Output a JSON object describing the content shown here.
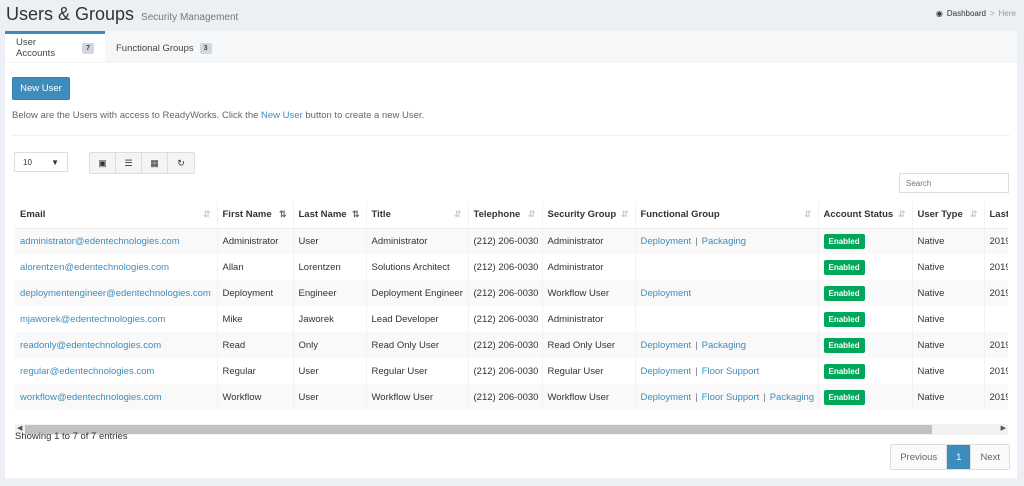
{
  "header": {
    "title": "Users & Groups",
    "subtitle": "Security Management"
  },
  "breadcrumb": {
    "home": "Dashboard",
    "sep": ">",
    "current": "Here"
  },
  "tabs": [
    {
      "label": "User Accounts",
      "count": "7"
    },
    {
      "label": "Functional Groups",
      "count": "3"
    }
  ],
  "new_user_label": "New User",
  "description": {
    "before": "Below are the Users with access to ReadyWorks. Click the ",
    "link": "New User",
    "after": " button to create a new User."
  },
  "page_length": "10",
  "search_placeholder": "Search",
  "columns": [
    "Email",
    "First Name",
    "Last Name",
    "Title",
    "Telephone",
    "Security Group",
    "Functional Group",
    "Account Status",
    "User Type",
    "Last"
  ],
  "rows": [
    {
      "email": "administrator@edentechnologies.com",
      "first": "Administrator",
      "last": "User",
      "title": "Administrator",
      "phone": "(212) 206-0030",
      "sec": "Administrator",
      "groups": [
        "Deployment",
        "Packaging"
      ],
      "status": "Enabled",
      "type": "Native",
      "lastcol": "2019"
    },
    {
      "email": "alorentzen@edentechnologies.com",
      "first": "Allan",
      "last": "Lorentzen",
      "title": "Solutions Architect",
      "phone": "(212) 206-0030",
      "sec": "Administrator",
      "groups": [],
      "status": "Enabled",
      "type": "Native",
      "lastcol": "2019"
    },
    {
      "email": "deploymentengineer@edentechnologies.com",
      "first": "Deployment",
      "last": "Engineer",
      "title": "Deployment Engineer",
      "phone": "(212) 206-0030",
      "sec": "Workflow User",
      "groups": [
        "Deployment"
      ],
      "status": "Enabled",
      "type": "Native",
      "lastcol": "2019"
    },
    {
      "email": "mjaworek@edentechnologies.com",
      "first": "Mike",
      "last": "Jaworek",
      "title": "Lead Developer",
      "phone": "(212) 206-0030",
      "sec": "Administrator",
      "groups": [],
      "status": "Enabled",
      "type": "Native",
      "lastcol": ""
    },
    {
      "email": "readonly@edentechnologies.com",
      "first": "Read",
      "last": "Only",
      "title": "Read Only User",
      "phone": "(212) 206-0030",
      "sec": "Read Only User",
      "groups": [
        "Deployment",
        "Packaging"
      ],
      "status": "Enabled",
      "type": "Native",
      "lastcol": "2019"
    },
    {
      "email": "regular@edentechnologies.com",
      "first": "Regular",
      "last": "User",
      "title": "Regular User",
      "phone": "(212) 206-0030",
      "sec": "Regular User",
      "groups": [
        "Deployment",
        "Floor Support"
      ],
      "status": "Enabled",
      "type": "Native",
      "lastcol": "2019"
    },
    {
      "email": "workflow@edentechnologies.com",
      "first": "Workflow",
      "last": "User",
      "title": "Workflow User",
      "phone": "(212) 206-0030",
      "sec": "Workflow User",
      "groups": [
        "Deployment",
        "Floor Support",
        "Packaging"
      ],
      "status": "Enabled",
      "type": "Native",
      "lastcol": "2019"
    }
  ],
  "info": "Showing 1 to 7 of 7 entries",
  "pager": {
    "prev": "Previous",
    "page": "1",
    "next": "Next"
  }
}
